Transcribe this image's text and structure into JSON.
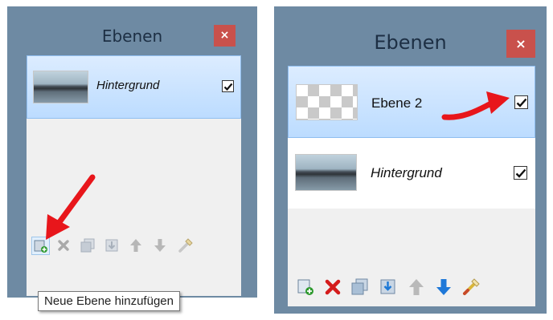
{
  "left_panel": {
    "title": "Ebenen",
    "close_label": "×",
    "layers": [
      {
        "name": "Hintergrund",
        "thumbnail": "landscape",
        "visible": true,
        "selected": true
      }
    ],
    "toolbar": [
      "add-layer-icon",
      "delete-layer-icon",
      "duplicate-layer-icon",
      "merge-down-icon",
      "move-up-icon",
      "move-down-icon",
      "properties-icon"
    ],
    "tooltip": "Neue Ebene hinzufügen",
    "toolbar_enabled": false
  },
  "right_panel": {
    "title": "Ebenen",
    "close_label": "×",
    "layers": [
      {
        "name": "Ebene 2",
        "thumbnail": "transparent",
        "visible": true,
        "selected": true
      },
      {
        "name": "Hintergrund",
        "thumbnail": "landscape",
        "visible": true,
        "selected": false
      }
    ],
    "toolbar": [
      "add-layer-icon",
      "delete-layer-icon",
      "duplicate-layer-icon",
      "merge-down-icon",
      "move-up-icon",
      "move-down-icon",
      "properties-icon"
    ],
    "toolbar_enabled": true
  },
  "colors": {
    "panel_frame": "#6e8aa3",
    "close_button": "#c9514c",
    "selection": "#c4e0ff",
    "annotation_arrow": "#e8161b"
  }
}
